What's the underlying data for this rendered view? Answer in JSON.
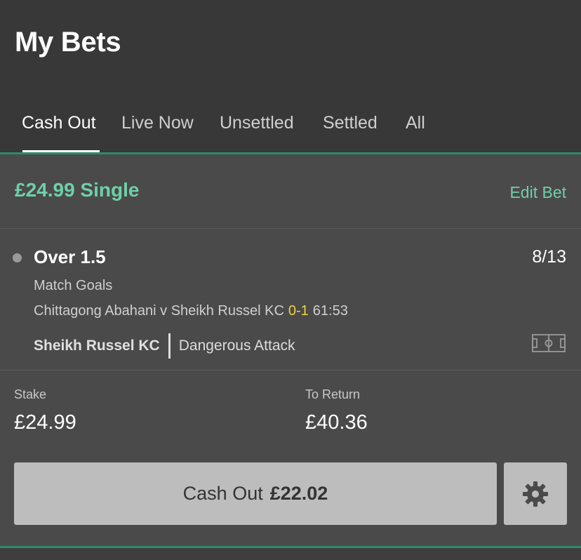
{
  "header": {
    "title": "My Bets"
  },
  "tabs": [
    {
      "label": "Cash Out",
      "active": true
    },
    {
      "label": "Live Now",
      "active": false
    },
    {
      "label": "Unsettled",
      "active": false
    },
    {
      "label": "Settled",
      "active": false
    },
    {
      "label": "All",
      "active": false
    }
  ],
  "bet": {
    "summary": "£24.99 Single",
    "edit_label": "Edit Bet",
    "selection": "Over 1.5",
    "odds": "8/13",
    "market": "Match Goals",
    "event": "Chittagong Abahani v Sheikh Russel KC",
    "score": "0-1",
    "clock": "61:53",
    "live_team": "Sheikh Russel KC",
    "live_event": "Dangerous Attack",
    "stake_label": "Stake",
    "stake_value": "£24.99",
    "return_label": "To Return",
    "return_value": "£40.36",
    "cashout_label": "Cash Out",
    "cashout_amount": "£22.02"
  },
  "colors": {
    "accent_green": "#6fd0a8",
    "divider_green": "#2e8a6a",
    "score_yellow": "#f3d13a",
    "header_bg": "#383838",
    "card_bg": "#4a4a4a",
    "button_bg": "#bdbdbd"
  },
  "icons": {
    "status": "status-dot-icon",
    "pitch": "football-pitch-icon",
    "settings": "gear-icon"
  }
}
